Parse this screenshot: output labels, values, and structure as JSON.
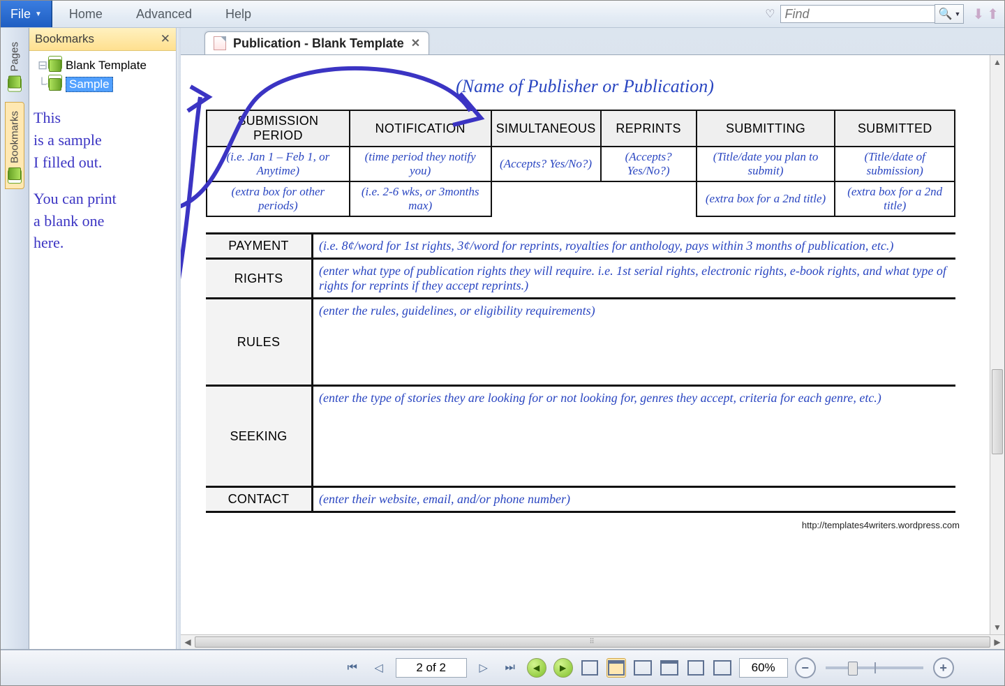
{
  "menu": {
    "file": "File",
    "home": "Home",
    "advanced": "Advanced",
    "help": "Help",
    "find_placeholder": "Find"
  },
  "side_tabs": {
    "pages": "Pages",
    "bookmarks": "Bookmarks"
  },
  "bookmarks": {
    "title": "Bookmarks",
    "items": [
      "Blank Template",
      "Sample"
    ],
    "selected_index": 1
  },
  "annot": {
    "line1": "This",
    "line2": "is a sample",
    "line3": "I filled out.",
    "line4": "You can print",
    "line5": "a blank one",
    "line6": "here."
  },
  "doc": {
    "tab_title": "Publication - Blank Template",
    "pub_title": "(Name of Publisher or Publication)",
    "grid_headers": [
      "SUBMISSION PERIOD",
      "NOTIFICATION",
      "SIMULTANEOUS",
      "REPRINTS",
      "SUBMITTING",
      "SUBMITTED"
    ],
    "grid_row1": [
      "(i.e. Jan 1 – Feb 1, or Anytime)",
      "(time period they notify you)",
      "(Accepts? Yes/No?)",
      "(Accepts? Yes/No?)",
      "(Title/date you plan to submit)",
      "(Title/date of submission)"
    ],
    "grid_row2": [
      "(extra box for other periods)",
      "(i.e. 2-6 wks, or 3months max)",
      "",
      "",
      "(extra box for a 2nd title)",
      "(extra box for a 2nd title)"
    ],
    "rows": [
      {
        "label": "PAYMENT",
        "value": "(i.e. 8¢/word for 1st rights, 3¢/word for reprints, royalties for anthology, pays within 3 months of publication, etc.)"
      },
      {
        "label": "RIGHTS",
        "value": "(enter what type of publication rights they will require.  i.e. 1st serial rights, electronic rights, e-book rights, and what type of rights for reprints if they accept reprints.)"
      },
      {
        "label": "RULES",
        "value": "(enter the rules, guidelines, or eligibility requirements)"
      },
      {
        "label": "SEEKING",
        "value": "(enter the type of stories they are looking for or not looking for, genres they accept, criteria for each genre, etc.)"
      },
      {
        "label": "CONTACT",
        "value": "(enter their website, email, and/or phone number)"
      }
    ],
    "footer_url": "http://templates4writers.wordpress.com"
  },
  "status": {
    "page": "2 of 2",
    "zoom": "60%"
  }
}
